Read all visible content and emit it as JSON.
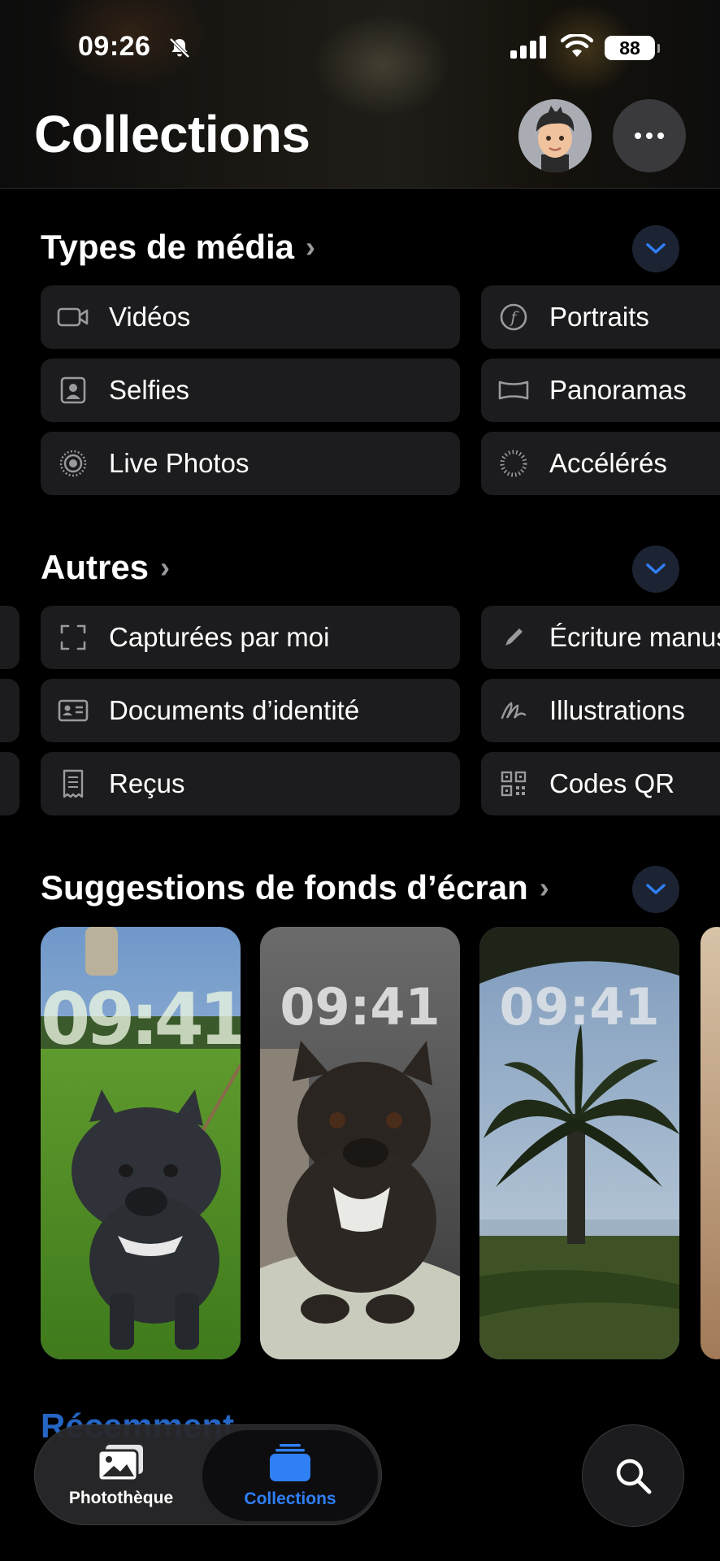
{
  "status_bar": {
    "time": "09:26",
    "battery": "88"
  },
  "header": {
    "title": "Collections"
  },
  "media_types": {
    "title": "Types de média",
    "items": [
      {
        "label": "Vidéos",
        "icon": "video-camera-icon"
      },
      {
        "label": "Portraits",
        "icon": "aperture-f-icon"
      },
      {
        "label": "Selfies",
        "icon": "selfie-person-icon"
      },
      {
        "label": "Panoramas",
        "icon": "panorama-icon"
      },
      {
        "label": "Live Photos",
        "icon": "live-photo-icon"
      },
      {
        "label": "Accélérés",
        "icon": "timelapse-icon"
      }
    ]
  },
  "others": {
    "title": "Autres",
    "items": [
      {
        "label": "Capturées par moi",
        "icon": "viewfinder-icon"
      },
      {
        "label": "Écriture manuscrite",
        "icon": "pencil-icon"
      },
      {
        "label": "Documents d’identité",
        "icon": "id-card-icon"
      },
      {
        "label": "Illustrations",
        "icon": "scribble-icon"
      },
      {
        "label": "Reçus",
        "icon": "receipt-icon"
      },
      {
        "label": "Codes QR",
        "icon": "qr-code-icon"
      }
    ]
  },
  "wallpapers": {
    "title": "Suggestions de fonds d’écran",
    "items": [
      {
        "clock": "09:41",
        "subject": "french bulldog on grass"
      },
      {
        "clock": "09:41",
        "subject": "french bulldog on blanket"
      },
      {
        "clock": "09:41",
        "subject": "palm tree and sea"
      }
    ]
  },
  "next_section_peek": "Récemment",
  "tab_bar": {
    "library": "Photothèque",
    "collections": "Collections"
  },
  "colors": {
    "accent": "#2f7ff5",
    "tile_bg": "#1c1c1e",
    "background": "#000000"
  }
}
